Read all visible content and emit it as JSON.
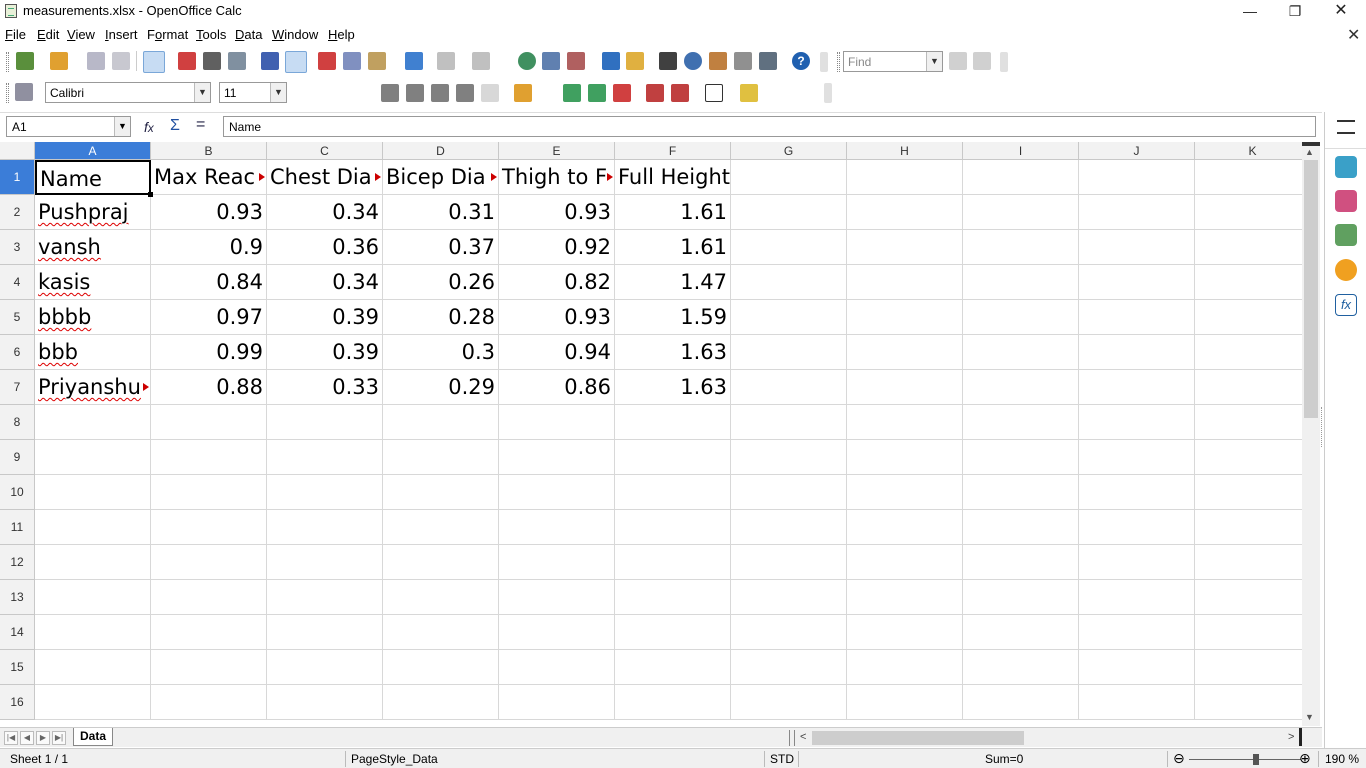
{
  "window": {
    "title": "measurements.xlsx - OpenOffice Calc"
  },
  "menu": [
    "File",
    "Edit",
    "View",
    "Insert",
    "Format",
    "Tools",
    "Data",
    "Window",
    "Help"
  ],
  "menu_underline": [
    "F",
    "E",
    "V",
    "I",
    "o",
    "T",
    "D",
    "W",
    "H"
  ],
  "toolbar": {
    "find_placeholder": "Find",
    "font_name": "Calibri",
    "font_size": "11"
  },
  "formula_bar": {
    "cell_ref": "A1",
    "content": "Name"
  },
  "columns": [
    "A",
    "B",
    "C",
    "D",
    "E",
    "F",
    "G",
    "H",
    "I",
    "J",
    "K"
  ],
  "rows": [
    "1",
    "2",
    "3",
    "4",
    "5",
    "6",
    "7",
    "8",
    "9",
    "10",
    "11",
    "12",
    "13",
    "14",
    "15",
    "16"
  ],
  "sheet": {
    "header": [
      "Name",
      "Max Reac",
      "Chest Dia",
      "Bicep Dia",
      "Thigh to F",
      "Full Height"
    ],
    "data": [
      [
        "Pushpraj",
        "0.93",
        "0.34",
        "0.31",
        "0.93",
        "1.61"
      ],
      [
        "vansh",
        "0.9",
        "0.36",
        "0.37",
        "0.92",
        "1.61"
      ],
      [
        "kasis",
        "0.84",
        "0.34",
        "0.26",
        "0.82",
        "1.47"
      ],
      [
        "bbbb",
        "0.97",
        "0.39",
        "0.28",
        "0.93",
        "1.59"
      ],
      [
        "bbb",
        "0.99",
        "0.39",
        "0.3",
        "0.94",
        "1.63"
      ],
      [
        "Priyanshu",
        "0.88",
        "0.33",
        "0.29",
        "0.86",
        "1.63"
      ]
    ]
  },
  "tabs": {
    "active_sheet": "Data"
  },
  "status": {
    "sheet": "Sheet 1 / 1",
    "page_style": "PageStyle_Data",
    "mode": "STD",
    "sum": "Sum=0",
    "zoom": "190 %"
  },
  "colors": {
    "selection": "#3b7dd8",
    "grid": "#d8d8d8",
    "spell": "#d00"
  }
}
